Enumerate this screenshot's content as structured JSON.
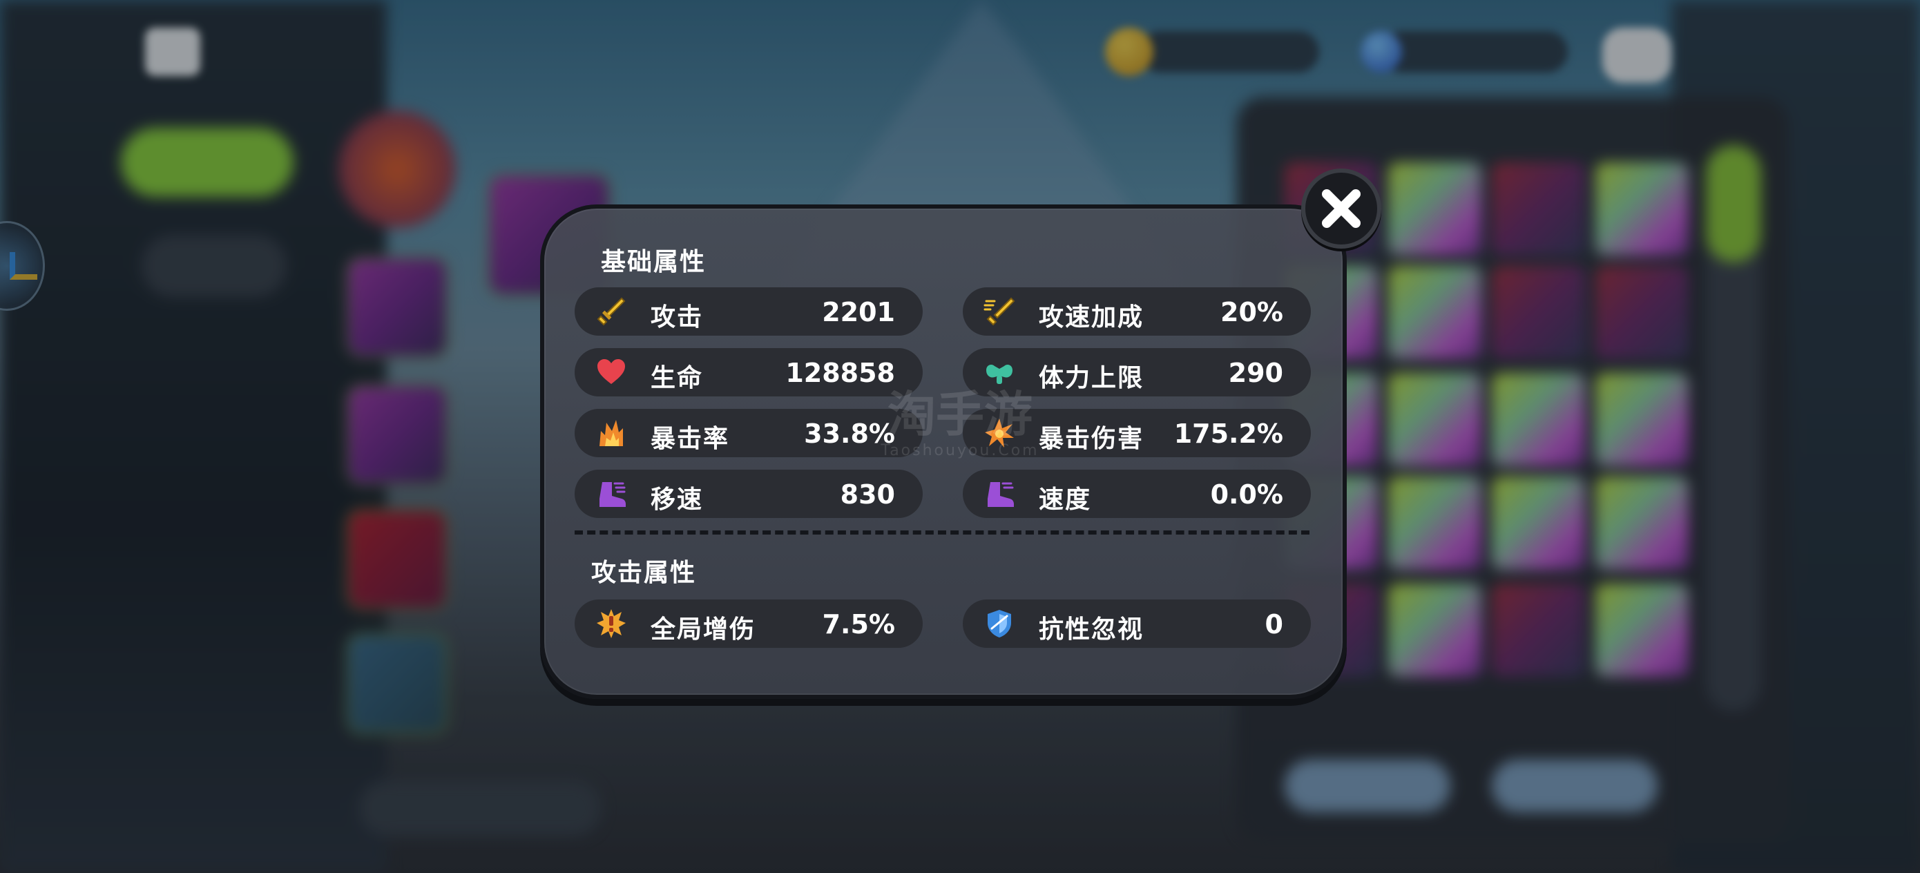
{
  "overlay": {
    "basic_section": {
      "title": "基础属性",
      "stats": [
        {
          "name": "attack",
          "label": "攻击",
          "value": "2201",
          "icon": "sword-icon",
          "color": "#f2c230"
        },
        {
          "name": "attack-speed-bonus",
          "label": "攻速加成",
          "value": "20%",
          "icon": "sword-speed-icon",
          "color": "#f2c230"
        },
        {
          "name": "health",
          "label": "生命",
          "value": "128858",
          "icon": "heart-icon",
          "color": "#e8434d"
        },
        {
          "name": "stamina-cap",
          "label": "体力上限",
          "value": "290",
          "icon": "muscle-icon",
          "color": "#3fc0a0"
        },
        {
          "name": "crit-rate",
          "label": "暴击率",
          "value": "33.8%",
          "icon": "flame-burst-icon",
          "color": "#f08a2c"
        },
        {
          "name": "crit-damage",
          "label": "暴击伤害",
          "value": "175.2%",
          "icon": "spiky-burst-icon",
          "color": "#f08a2c"
        },
        {
          "name": "move-speed",
          "label": "移速",
          "value": "830",
          "icon": "boot-icon",
          "color": "#9b4fd6"
        },
        {
          "name": "speed",
          "label": "速度",
          "value": "0.0%",
          "icon": "boot-icon",
          "color": "#9b4fd6"
        }
      ]
    },
    "attack_section": {
      "title": "攻击属性",
      "stats": [
        {
          "name": "global-damage-boost",
          "label": "全局增伤",
          "value": "7.5%",
          "icon": "exclaim-burst-icon",
          "color": "#f2a630"
        },
        {
          "name": "resist-ignore",
          "label": "抗性忽视",
          "value": "0",
          "icon": "shield-slash-icon",
          "color": "#3b8ae0"
        }
      ]
    },
    "close_icon": "close-icon"
  },
  "watermark": {
    "main": "淘手游",
    "sub": "Taoshouyou.Com"
  }
}
